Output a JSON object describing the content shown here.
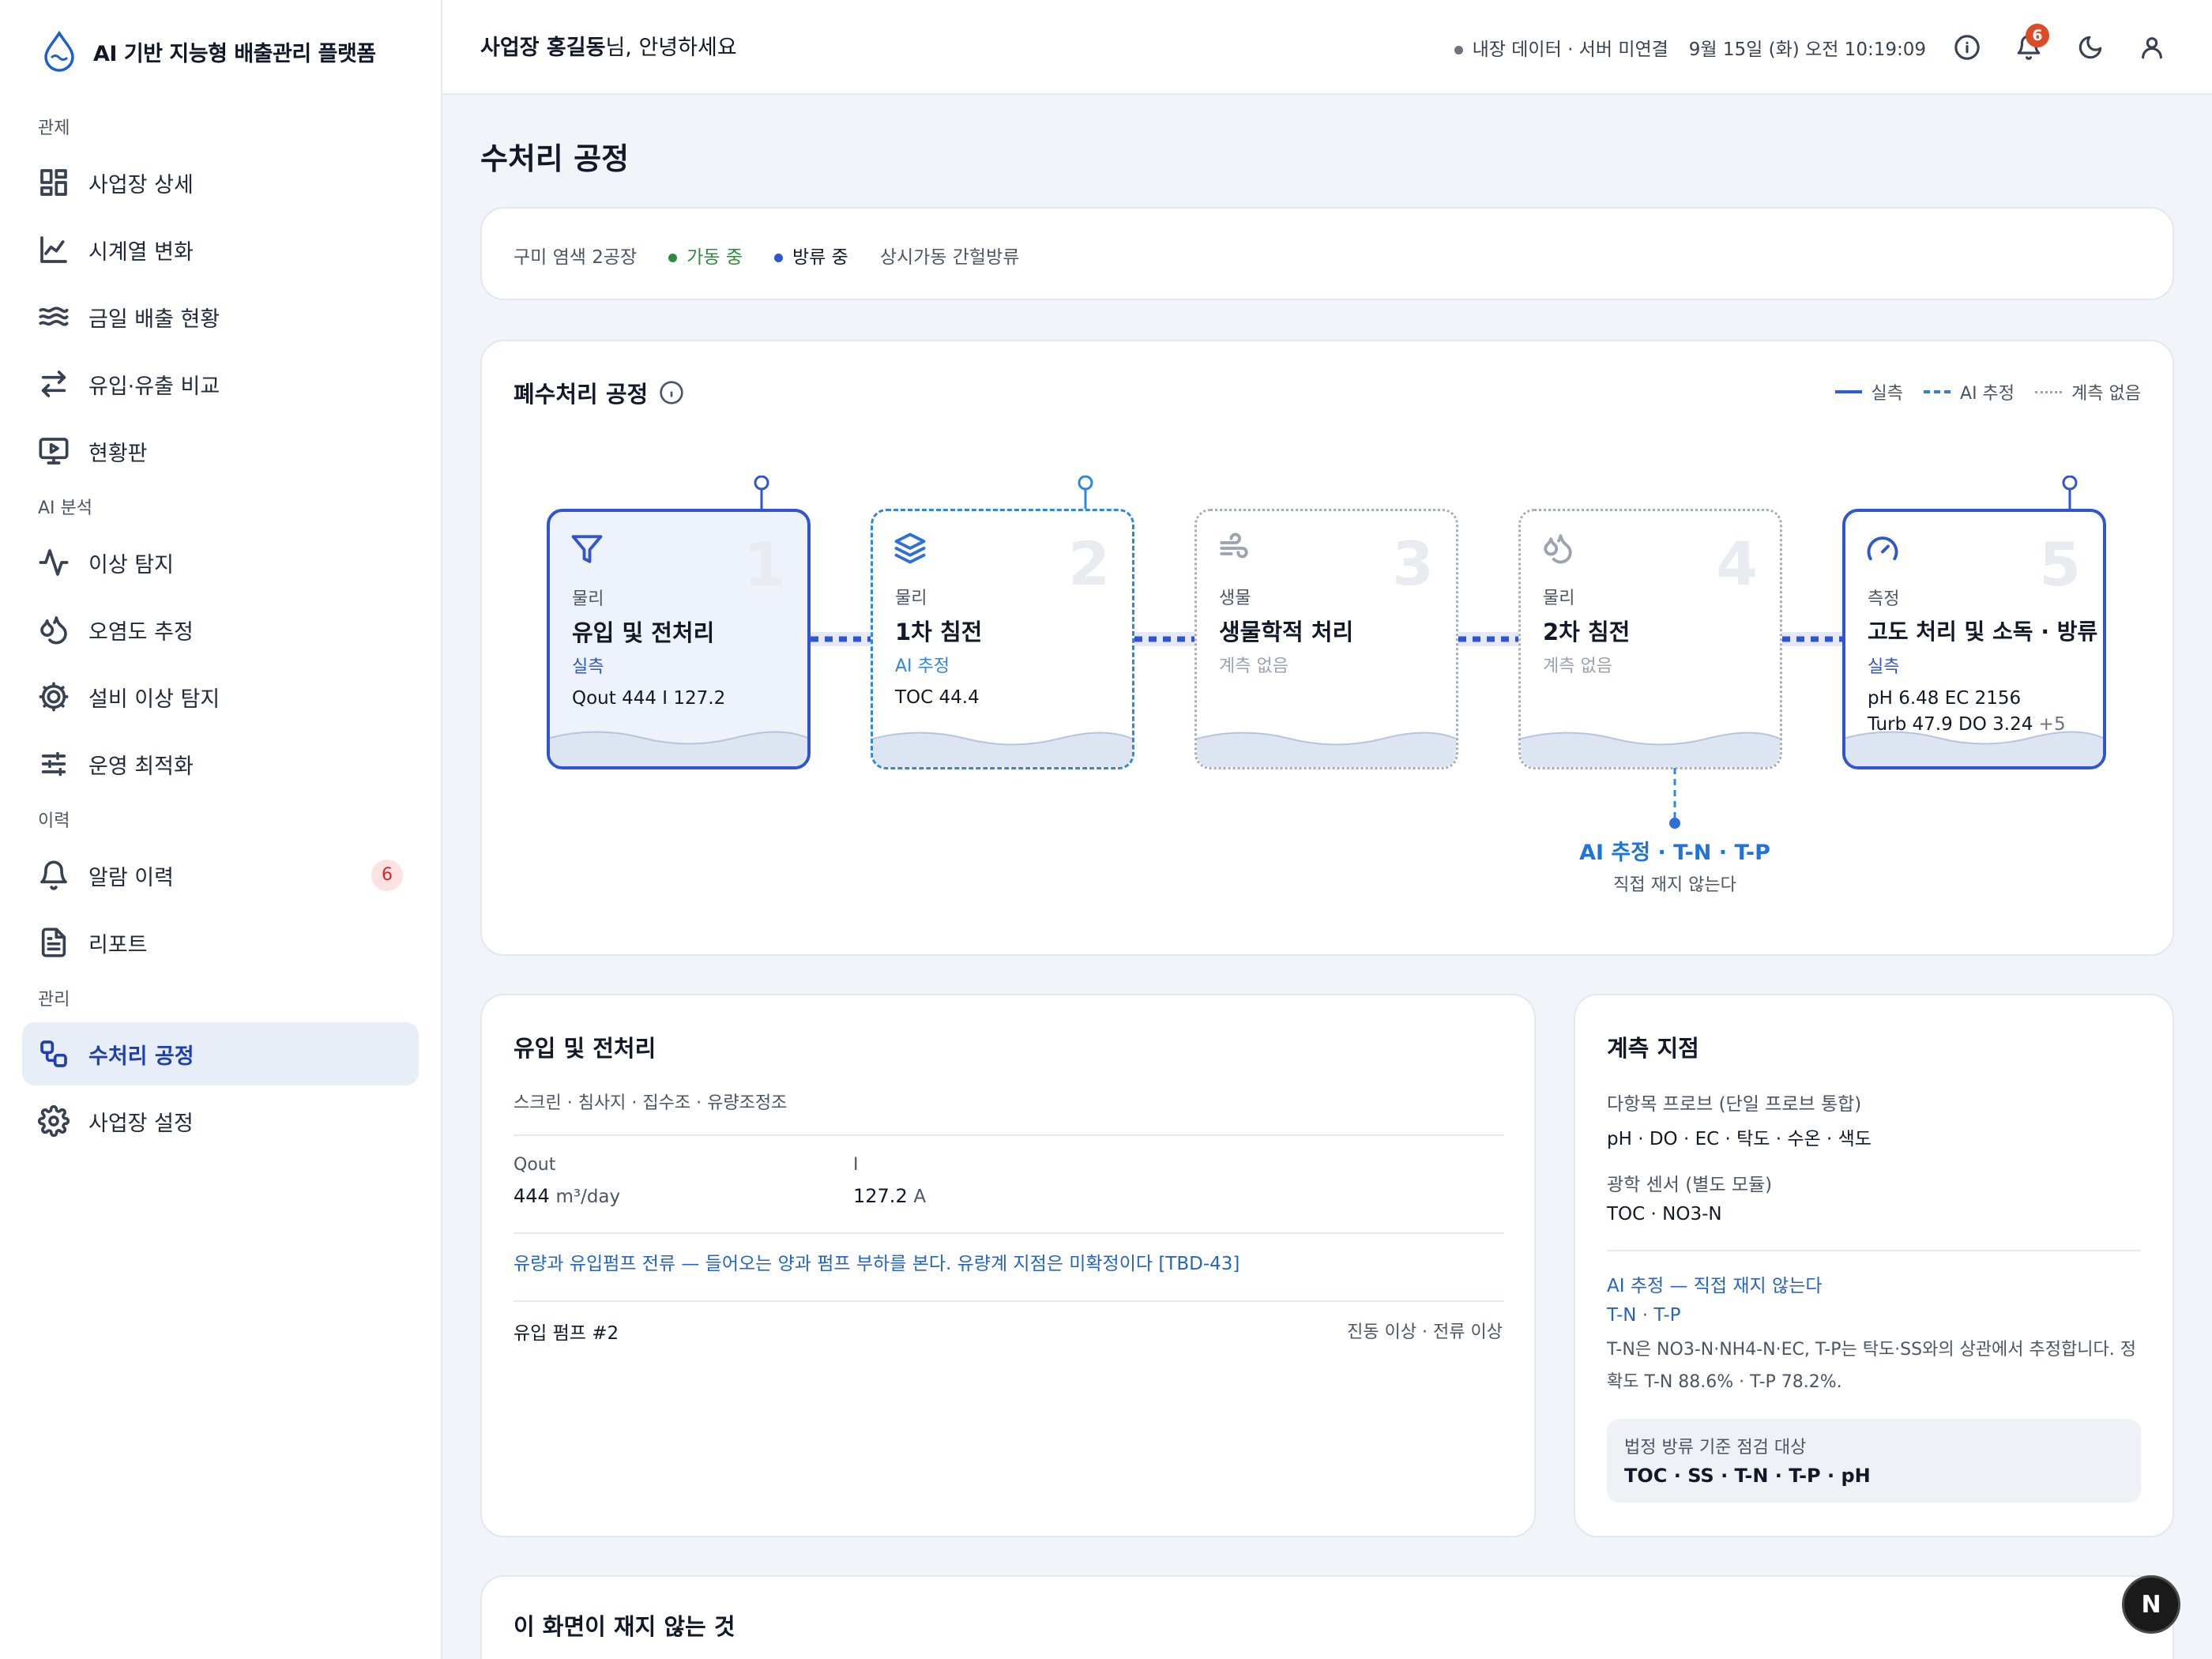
{
  "app": {
    "title": "AI 기반 지능형 배출관리 플랫폼"
  },
  "sidebar": {
    "sections": [
      {
        "label": "관제",
        "items": [
          {
            "label": "사업장 상세",
            "icon": "grid-icon"
          },
          {
            "label": "시계열 변화",
            "icon": "line-chart-icon"
          },
          {
            "label": "금일 배출 현황",
            "icon": "waves-icon"
          },
          {
            "label": "유입·유출 비교",
            "icon": "swap-arrows-icon"
          },
          {
            "label": "현황판",
            "icon": "monitor-play-icon"
          }
        ]
      },
      {
        "label": "AI 분석",
        "items": [
          {
            "label": "이상 탐지",
            "icon": "activity-icon"
          },
          {
            "label": "오염도 추정",
            "icon": "droplets-icon"
          },
          {
            "label": "설비 이상 탐지",
            "icon": "cog-icon"
          },
          {
            "label": "운영 최적화",
            "icon": "sliders-icon"
          }
        ]
      },
      {
        "label": "이력",
        "items": [
          {
            "label": "알람 이력",
            "icon": "bell-icon",
            "badge": "6"
          },
          {
            "label": "리포트",
            "icon": "file-text-icon"
          }
        ]
      },
      {
        "label": "관리",
        "items": [
          {
            "label": "수처리 공정",
            "icon": "workflow-icon",
            "active": true
          },
          {
            "label": "사업장 설정",
            "icon": "settings-icon"
          }
        ]
      }
    ]
  },
  "topbar": {
    "greeting_name": "사업장 홍길동",
    "greeting_suffix": "님, 안녕하세요",
    "data_status": "내장 데이터 · 서버 미연결",
    "datetime": "9월 15일 (화) 오전 10:19:09",
    "notification_count": "6"
  },
  "page": {
    "title": "수처리 공정"
  },
  "status": {
    "site": "구미 염색 2공장",
    "operating": "가동 중",
    "discharging": "방류 중",
    "mode": "상시가동 간헐방류",
    "colors": {
      "operating": "#2e8b3d",
      "discharging": "#2f56d0"
    }
  },
  "process": {
    "title": "폐수처리 공정",
    "legend": {
      "real": "실측",
      "ai": "AI 추정",
      "none": "계측 없음"
    },
    "stages": [
      {
        "num": "1",
        "icon": "filter-icon",
        "category": "물리",
        "name": "유입 및 전처리",
        "kind": "실측",
        "line1": "Qout 444 I 127.2",
        "line2": "",
        "more": ""
      },
      {
        "num": "2",
        "icon": "layers-icon",
        "category": "물리",
        "name": "1차 침전",
        "kind": "AI 추정",
        "line1": "TOC 44.4",
        "line2": "",
        "more": ""
      },
      {
        "num": "3",
        "icon": "wind-icon",
        "category": "생물",
        "name": "생물학적 처리",
        "kind": "계측 없음",
        "line1": "",
        "line2": "",
        "more": ""
      },
      {
        "num": "4",
        "icon": "droplets-icon",
        "category": "물리",
        "name": "2차 침전",
        "kind": "계측 없음",
        "line1": "",
        "line2": "",
        "more": ""
      },
      {
        "num": "5",
        "icon": "gauge-icon",
        "category": "측정",
        "name": "고도 처리 및 소독 · 방류",
        "kind": "실측",
        "line1": "pH 6.48 EC 2156",
        "line2": "Turb 47.9 DO 3.24",
        "more": "+5"
      }
    ],
    "ai_callout": {
      "title": "AI 추정 · T-N · T-P",
      "sub": "직접 재지 않는다"
    }
  },
  "detail": {
    "title": "유입 및 전처리",
    "sub": "스크린 · 침사지 · 집수조 · 유량조정조",
    "metrics": [
      {
        "label": "Qout",
        "value": "444",
        "unit": "m³/day"
      },
      {
        "label": "I",
        "value": "127.2",
        "unit": "A"
      }
    ],
    "note": "유량과 유입펌프 전류 — 들어오는 양과 펌프 부하를 본다. 유량계 지점은 미확정이다 [TBD-43]",
    "pump": "유입 펌프 #2",
    "pump_flags": "진동 이상 · 전류 이상"
  },
  "measure": {
    "title": "계측 지점",
    "probe_label": "다항목 프로브 (단일 프로브 통합)",
    "probe_value": "pH · DO · EC · 탁도 · 수온 · 색도",
    "optic_label": "광학 센서 (별도 모듈)",
    "optic_value": "TOC · NO3-N",
    "ai_label": "AI 추정 — 직접 재지 않는다",
    "ai_value": "T-N · T-P",
    "ai_desc": "T-N은 NO3-N·NH4-N·EC, T-P는 탁도·SS와의 상관에서 추정합니다. 정확도 T-N 88.6% · T-P 78.2%.",
    "legal_label": "법정 방류 기준 점검 대상",
    "legal_value": "TOC · SS · T-N · T-P · pH"
  },
  "bottom": {
    "title": "이 화면이 재지 않는 것"
  },
  "fab": {
    "label": "N"
  }
}
